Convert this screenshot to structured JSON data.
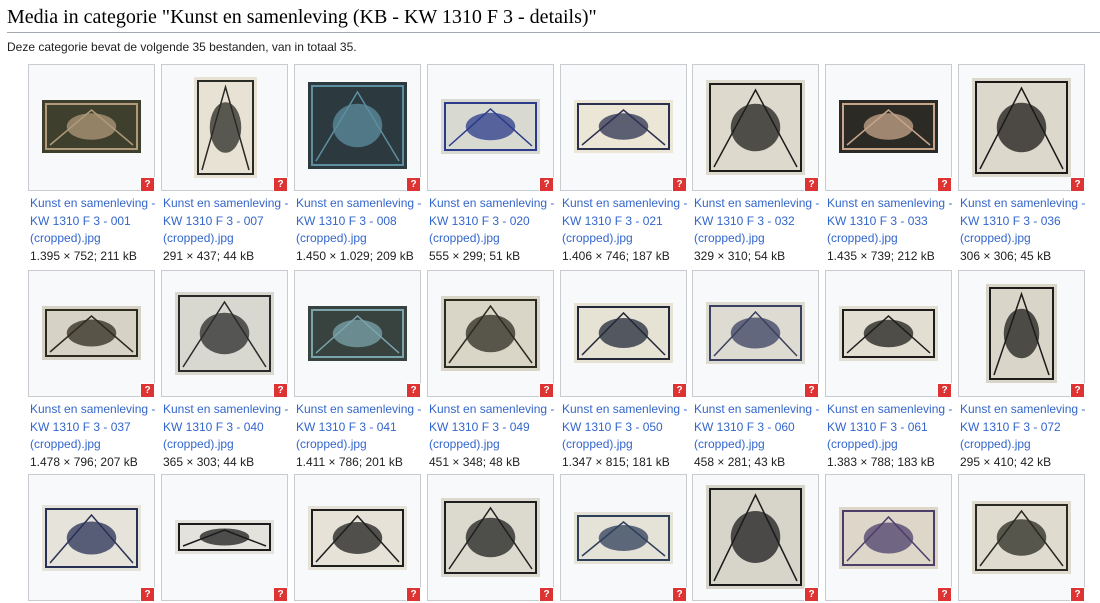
{
  "page": {
    "title": "Media in categorie \"Kunst en samenleving (KB - KW 1310 F 3 - details)\"",
    "intro": "Deze categorie bevat de volgende 35 bestanden, van in totaal 35."
  },
  "badge_label": "?",
  "items": [
    {
      "line1": "Kunst en samenleving -",
      "line2": "KW 1310 F 3 - 001",
      "line3": "(cropped).jpg",
      "meta": "1.395 × 752; 211 kB",
      "icon": "artwork-thumbnail"
    },
    {
      "line1": "Kunst en samenleving -",
      "line2": "KW 1310 F 3 - 007",
      "line3": "(cropped).jpg",
      "meta": "291 × 437; 44 kB",
      "icon": "artwork-thumbnail"
    },
    {
      "line1": "Kunst en samenleving -",
      "line2": "KW 1310 F 3 - 008",
      "line3": "(cropped).jpg",
      "meta": "1.450 × 1.029; 209 kB",
      "icon": "artwork-thumbnail"
    },
    {
      "line1": "Kunst en samenleving -",
      "line2": "KW 1310 F 3 - 020",
      "line3": "(cropped).jpg",
      "meta": "555 × 299; 51 kB",
      "icon": "artwork-thumbnail"
    },
    {
      "line1": "Kunst en samenleving -",
      "line2": "KW 1310 F 3 - 021",
      "line3": "(cropped).jpg",
      "meta": "1.406 × 746; 187 kB",
      "icon": "artwork-thumbnail"
    },
    {
      "line1": "Kunst en samenleving -",
      "line2": "KW 1310 F 3 - 032",
      "line3": "(cropped).jpg",
      "meta": "329 × 310; 54 kB",
      "icon": "artwork-thumbnail"
    },
    {
      "line1": "Kunst en samenleving -",
      "line2": "KW 1310 F 3 - 033",
      "line3": "(cropped).jpg",
      "meta": "1.435 × 739; 212 kB",
      "icon": "artwork-thumbnail"
    },
    {
      "line1": "Kunst en samenleving -",
      "line2": "KW 1310 F 3 - 036",
      "line3": "(cropped).jpg",
      "meta": "306 × 306; 45 kB",
      "icon": "artwork-thumbnail"
    },
    {
      "line1": "Kunst en samenleving -",
      "line2": "KW 1310 F 3 - 037",
      "line3": "(cropped).jpg",
      "meta": "1.478 × 796; 207 kB",
      "icon": "artwork-thumbnail"
    },
    {
      "line1": "Kunst en samenleving -",
      "line2": "KW 1310 F 3 - 040",
      "line3": "(cropped).jpg",
      "meta": "365 × 303; 44 kB",
      "icon": "artwork-thumbnail"
    },
    {
      "line1": "Kunst en samenleving -",
      "line2": "KW 1310 F 3 - 041",
      "line3": "(cropped).jpg",
      "meta": "1.411 × 786; 201 kB",
      "icon": "artwork-thumbnail"
    },
    {
      "line1": "Kunst en samenleving -",
      "line2": "KW 1310 F 3 - 049",
      "line3": "(cropped).jpg",
      "meta": "451 × 348; 48 kB",
      "icon": "artwork-thumbnail"
    },
    {
      "line1": "Kunst en samenleving -",
      "line2": "KW 1310 F 3 - 050",
      "line3": "(cropped).jpg",
      "meta": "1.347 × 815; 181 kB",
      "icon": "artwork-thumbnail"
    },
    {
      "line1": "Kunst en samenleving -",
      "line2": "KW 1310 F 3 - 060",
      "line3": "(cropped).jpg",
      "meta": "458 × 281; 43 kB",
      "icon": "artwork-thumbnail"
    },
    {
      "line1": "Kunst en samenleving -",
      "line2": "KW 1310 F 3 - 061",
      "line3": "(cropped).jpg",
      "meta": "1.383 × 788; 183 kB",
      "icon": "artwork-thumbnail"
    },
    {
      "line1": "Kunst en samenleving -",
      "line2": "KW 1310 F 3 - 072",
      "line3": "(cropped).jpg",
      "meta": "295 × 410; 42 kB",
      "icon": "artwork-thumbnail"
    },
    {
      "line1": "",
      "line2": "",
      "line3": "",
      "meta": "",
      "icon": "artwork-thumbnail"
    },
    {
      "line1": "",
      "line2": "",
      "line3": "",
      "meta": "",
      "icon": "artwork-thumbnail"
    },
    {
      "line1": "",
      "line2": "",
      "line3": "",
      "meta": "",
      "icon": "artwork-thumbnail"
    },
    {
      "line1": "",
      "line2": "",
      "line3": "",
      "meta": "",
      "icon": "artwork-thumbnail"
    },
    {
      "line1": "",
      "line2": "",
      "line3": "",
      "meta": "",
      "icon": "artwork-thumbnail"
    },
    {
      "line1": "",
      "line2": "",
      "line3": "",
      "meta": "",
      "icon": "artwork-thumbnail"
    },
    {
      "line1": "",
      "line2": "",
      "line3": "",
      "meta": "",
      "icon": "artwork-thumbnail"
    },
    {
      "line1": "",
      "line2": "",
      "line3": "",
      "meta": "",
      "icon": "artwork-thumbnail"
    }
  ]
}
